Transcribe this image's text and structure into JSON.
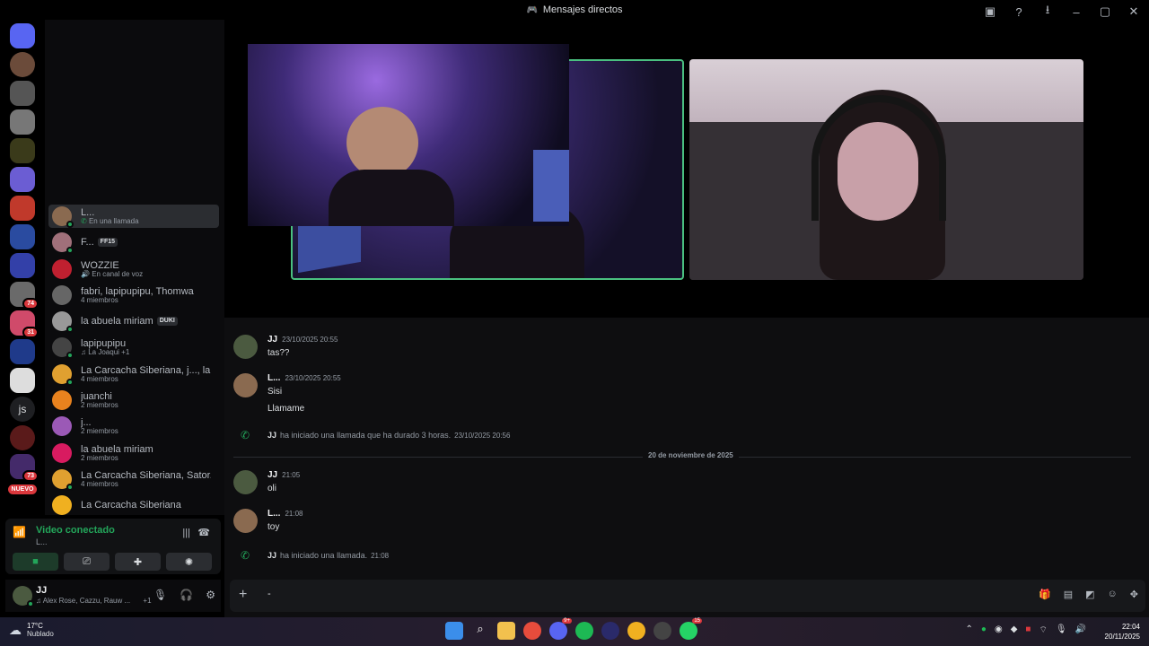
{
  "window": {
    "title": "Mensajes directos"
  },
  "dm_list": [
    {
      "name": "L...",
      "sub": "En una llamada",
      "sub_icon": "phone"
    },
    {
      "name": "F...",
      "tag": "FF15"
    },
    {
      "name": "WOZZIE",
      "sub": "En canal de voz"
    },
    {
      "name": "fabri, lapipupipu, Thomwa",
      "sub": "4 miembros"
    },
    {
      "name": "la abuela miriam",
      "tag": "DUKI"
    },
    {
      "name": "lapipupipu",
      "sub": "La Joaqui +1"
    },
    {
      "name": "La Carcacha Siberiana, j..., la...",
      "sub": "4 miembros"
    },
    {
      "name": "juanchi",
      "sub": "2 miembros"
    },
    {
      "name": "j...",
      "sub": "2 miembros"
    },
    {
      "name": "la abuela miriam",
      "sub": "2 miembros"
    },
    {
      "name": "La Carcacha Siberiana, Sator...",
      "sub": "4 miembros"
    },
    {
      "name": "La Carcacha Siberiana"
    }
  ],
  "server_rail": {
    "badges": [
      "74",
      "31",
      "73"
    ],
    "js_label": "js",
    "nuevo_label": "NUEVO"
  },
  "voice_panel": {
    "status": "Video conectado",
    "channel": "L..."
  },
  "user": {
    "name": "JJ",
    "activity": "Alex Rose, Cazzu, Rauw ...",
    "activity_extra": "+1"
  },
  "chat": {
    "messages": [
      {
        "author": "JJ",
        "time": "23/10/2025 20:55",
        "lines": [
          "tas??"
        ]
      },
      {
        "author": "L...",
        "time": "23/10/2025 20:55",
        "lines": [
          "Sisi",
          "Llamame"
        ]
      },
      {
        "author": "JJ",
        "time": "21:05",
        "lines": [
          "oli"
        ]
      },
      {
        "author": "L...",
        "time": "21:08",
        "lines": [
          "toy"
        ]
      }
    ],
    "system": [
      {
        "author": "JJ",
        "text": "ha iniciado una llamada que ha durado 3 horas.",
        "time": "23/10/2025 20:56"
      },
      {
        "author": "JJ",
        "text": "ha iniciado una llamada.",
        "time": "21:08"
      }
    ],
    "date_divider": "20 de noviembre de 2025",
    "composer_text": "-"
  },
  "taskbar": {
    "temperature": "17°C",
    "weather": "Nublado",
    "app_badges": [
      "9+",
      "15"
    ],
    "time": "22:04",
    "date": "20/11/2025"
  },
  "colors": {
    "accent_green": "#23a55a",
    "badge_red": "#da373c",
    "blurple": "#5865f2"
  }
}
